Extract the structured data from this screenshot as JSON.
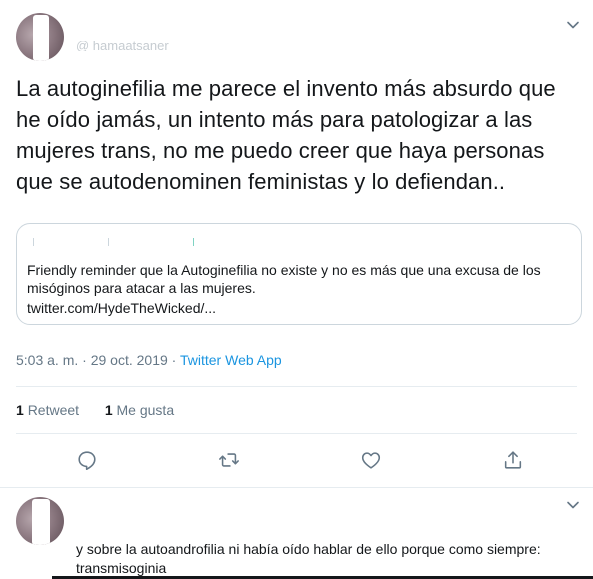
{
  "main_tweet": {
    "handle_redacted": "@ hamaatsaner",
    "text": "La autoginefilia me parece el invento más absurdo que he oído jamás, un intento más para patologizar a las mujeres trans, no me puedo creer que haya personas que se autodenominen feministas y lo defiendan..",
    "quoted_tweet": {
      "text": "Friendly reminder que la Autoginefilia no existe y no es más que una excusa de los misóginos para atacar a las mujeres.",
      "link": "twitter.com/HydeTheWicked/..."
    },
    "time": "5:03 a. m.",
    "date": "29 oct. 2019",
    "separator": "·",
    "source": "Twitter Web App",
    "stats": {
      "retweets_count": "1",
      "retweets_label": "Retweet",
      "likes_count": "1",
      "likes_label": "Me gusta"
    },
    "actions": [
      "reply-icon",
      "retweet-icon",
      "like-icon",
      "share-icon"
    ]
  },
  "reply_tweet": {
    "text": "y sobre la autoandrofilia ni había oído hablar de ello porque como siempre: transmisoginia"
  },
  "colors": {
    "text": "#14171a",
    "secondary": "#657786",
    "link": "#1b95e0",
    "border": "#e6ecf0"
  }
}
